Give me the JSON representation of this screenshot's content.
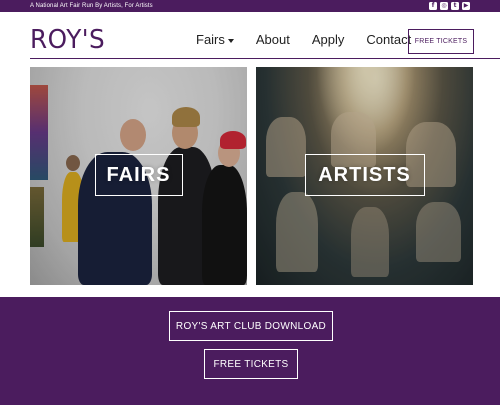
{
  "topbar": {
    "tagline": "A National Art Fair Run By Artists, For Artists",
    "socials": [
      {
        "icon": "facebook-icon",
        "glyph": "f"
      },
      {
        "icon": "instagram-icon",
        "glyph": "◎"
      },
      {
        "icon": "twitter-icon",
        "glyph": "t"
      },
      {
        "icon": "youtube-icon",
        "glyph": "▶"
      }
    ]
  },
  "header": {
    "logo": "ROY'S",
    "nav": [
      {
        "label": "Fairs",
        "has_dropdown": true
      },
      {
        "label": "About",
        "has_dropdown": false
      },
      {
        "label": "Apply",
        "has_dropdown": false
      },
      {
        "label": "Contact",
        "has_dropdown": false
      }
    ],
    "cta": "FREE TICKETS"
  },
  "tiles": [
    {
      "label": "FAIRS"
    },
    {
      "label": "ARTISTS"
    }
  ],
  "band": {
    "download_label": "ROY'S ART CLUB DOWNLOAD",
    "tickets_label": "FREE TICKETS"
  },
  "colors": {
    "brand": "#4b1c5e",
    "white": "#ffffff"
  }
}
